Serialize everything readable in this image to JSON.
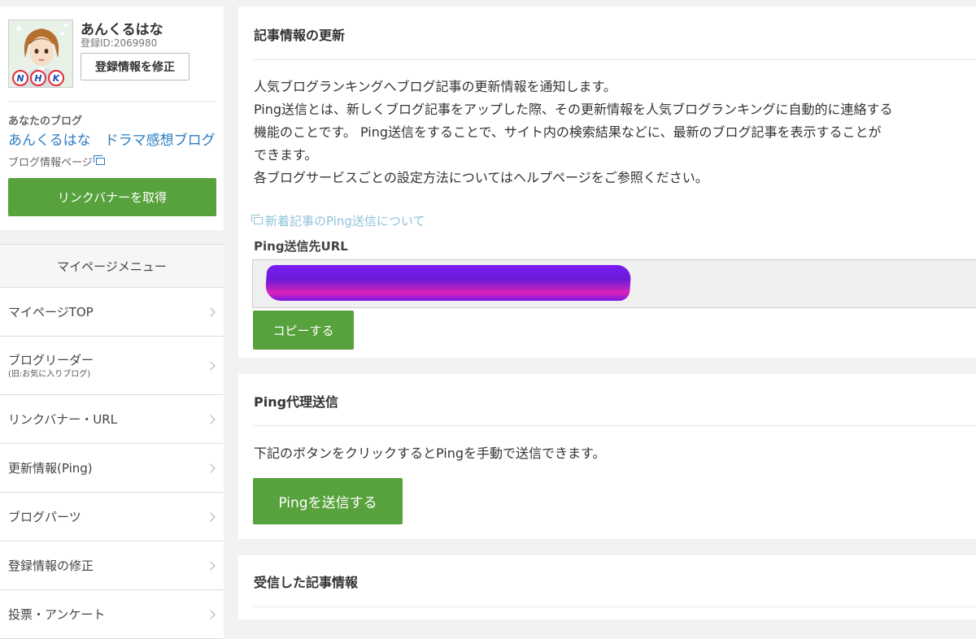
{
  "profile": {
    "username": "あんくるはな",
    "user_id": "登録ID:2069980",
    "edit_button": "登録情報を修正",
    "your_blog_label": "あなたのブログ",
    "blog_name": "あんくるはな　ドラマ感想ブログ",
    "blog_info_link": "ブログ情報ページ",
    "banner_button": "リンクバナーを取得",
    "avatar_letters": [
      "N",
      "H",
      "K"
    ]
  },
  "menu": {
    "header": "マイページメニュー",
    "items": [
      {
        "label": "マイページTOP",
        "sub": ""
      },
      {
        "label": "ブログリーダー",
        "sub": "(旧:お気に入りブログ)"
      },
      {
        "label": "リンクバナー・URL",
        "sub": ""
      },
      {
        "label": "更新情報(Ping)",
        "sub": ""
      },
      {
        "label": "ブログパーツ",
        "sub": ""
      },
      {
        "label": "登録情報の修正",
        "sub": ""
      },
      {
        "label": "投票・アンケート",
        "sub": ""
      }
    ]
  },
  "update_panel": {
    "title": "記事情報の更新",
    "desc_lines": [
      "人気ブログランキングへブログ記事の更新情報を通知します。",
      "Ping送信とは、新しくブログ記事をアップした際、その更新情報を人気ブログランキングに自動的に連絡する",
      "機能のことです。 Ping送信をすることで、サイト内の検索結果などに、最新のブログ記事を表示することが",
      "できます。",
      "各ブログサービスごとの設定方法についてはヘルプページをご参照ください。"
    ],
    "help_link": "新着記事のPing送信について",
    "url_label": "Ping送信先URL",
    "copy_button": "コピーする"
  },
  "proxy_panel": {
    "title": "Ping代理送信",
    "desc": "下記のボタンをクリックするとPingを手動で送信できます。",
    "send_button": "Pingを送信する"
  },
  "received_panel": {
    "title": "受信した記事情報"
  },
  "colors": {
    "accent_green": "#57a23d",
    "link_blue": "#2a7cc4",
    "help_link_blue": "#8ec2dd"
  }
}
